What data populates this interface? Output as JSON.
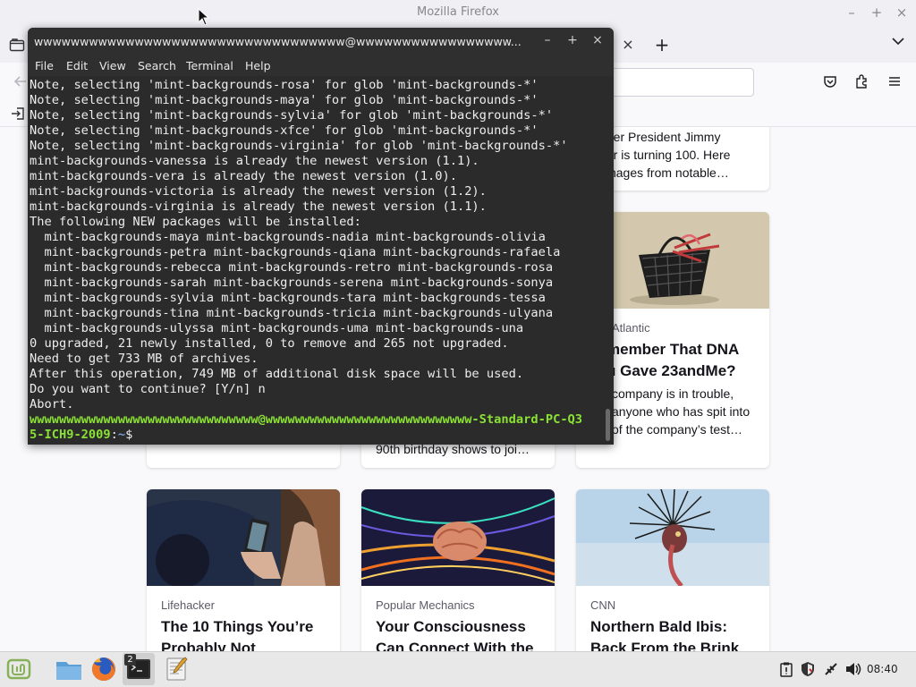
{
  "firefox": {
    "window_title": "Mozilla Firefox",
    "minimize_glyph": "–",
    "maximize_glyph": "+",
    "close_glyph": "×",
    "tab_close_glyph": "×",
    "new_tab_glyph": "+",
    "all_tabs_glyph": "∨",
    "cards": [
      {
        "title_lines": [
          "mer President Jimmy",
          "ter is turning 100. Here",
          "images from notable…"
        ]
      },
      {
        "source": "Atlantic",
        "title_lines": [
          "member That DNA",
          "u Gave 23andMe?"
        ],
        "excerpt_lines": [
          "company is in trouble,",
          "anyone who has spit into",
          "of the company’s test…"
        ]
      },
      {
        "excerpt_lines": [
          "90th birthday shows to joi…"
        ]
      },
      {
        "source": "Lifehacker",
        "title_lines": [
          "The 10 Things You’re",
          "Probably Not"
        ]
      },
      {
        "source": "Popular Mechanics",
        "title_lines": [
          "Your Consciousness",
          "Can Connect With the"
        ]
      },
      {
        "source": "CNN",
        "title_lines": [
          "Northern Bald Ibis:",
          "Back From the Brink"
        ]
      }
    ]
  },
  "terminal": {
    "title": "wwwwwwwwwwwwwwwwwwwwwwwwwwwwwwwwww@wwwwwwwwwwwwwwwww...",
    "minimize_glyph": "–",
    "maximize_glyph": "+",
    "close_glyph": "×",
    "menu": [
      "File",
      "Edit",
      "View",
      "Search",
      "Terminal",
      "Help"
    ],
    "lines": [
      "Note, selecting 'mint-backgrounds-rosa' for glob 'mint-backgrounds-*'",
      "Note, selecting 'mint-backgrounds-maya' for glob 'mint-backgrounds-*'",
      "Note, selecting 'mint-backgrounds-sylvia' for glob 'mint-backgrounds-*'",
      "Note, selecting 'mint-backgrounds-xfce' for glob 'mint-backgrounds-*'",
      "Note, selecting 'mint-backgrounds-virginia' for glob 'mint-backgrounds-*'",
      "mint-backgrounds-vanessa is already the newest version (1.1).",
      "mint-backgrounds-vera is already the newest version (1.0).",
      "mint-backgrounds-victoria is already the newest version (1.2).",
      "mint-backgrounds-virginia is already the newest version (1.1).",
      "The following NEW packages will be installed:",
      "  mint-backgrounds-maya mint-backgrounds-nadia mint-backgrounds-olivia",
      "  mint-backgrounds-petra mint-backgrounds-qiana mint-backgrounds-rafaela",
      "  mint-backgrounds-rebecca mint-backgrounds-retro mint-backgrounds-rosa",
      "  mint-backgrounds-sarah mint-backgrounds-serena mint-backgrounds-sonya",
      "  mint-backgrounds-sylvia mint-backgrounds-tara mint-backgrounds-tessa",
      "  mint-backgrounds-tina mint-backgrounds-tricia mint-backgrounds-ulyana",
      "  mint-backgrounds-ulyssa mint-backgrounds-uma mint-backgrounds-una",
      "0 upgraded, 21 newly installed, 0 to remove and 265 not upgraded.",
      "Need to get 733 MB of archives.",
      "After this operation, 749 MB of additional disk space will be used.",
      "Do you want to continue? [Y/n] n",
      "Abort."
    ],
    "prompt_user_host_line1": "wwwwwwwwwwwwwwwwwwwwwwwwwwwwwww@wwwwwwwwwwwwwwwwwwwwwwwwwwww-Standard-PC-Q3",
    "prompt_user_host_line2": "5-ICH9-2009",
    "prompt_colon": ":",
    "prompt_path": "~",
    "prompt_symbol": "$"
  },
  "taskbar": {
    "terminal_badge": "2",
    "clock": "08:40"
  },
  "colors": {
    "terminal_bg": "#2b2b2b",
    "prompt_green": "#8ae234",
    "prompt_blue": "#729fcf",
    "mint_green": "#87b158"
  },
  "icons": [
    "menu-mint-logo-icon",
    "files-folder-icon",
    "firefox-icon",
    "terminal-icon",
    "text-editor-icon",
    "clipboard-icon",
    "shield-icon",
    "network-icon",
    "volume-icon",
    "pocket-icon",
    "extensions-icon",
    "hamburger-menu-icon",
    "import-bookmarks-icon",
    "back-arrow-icon",
    "tab-folder-icon"
  ]
}
